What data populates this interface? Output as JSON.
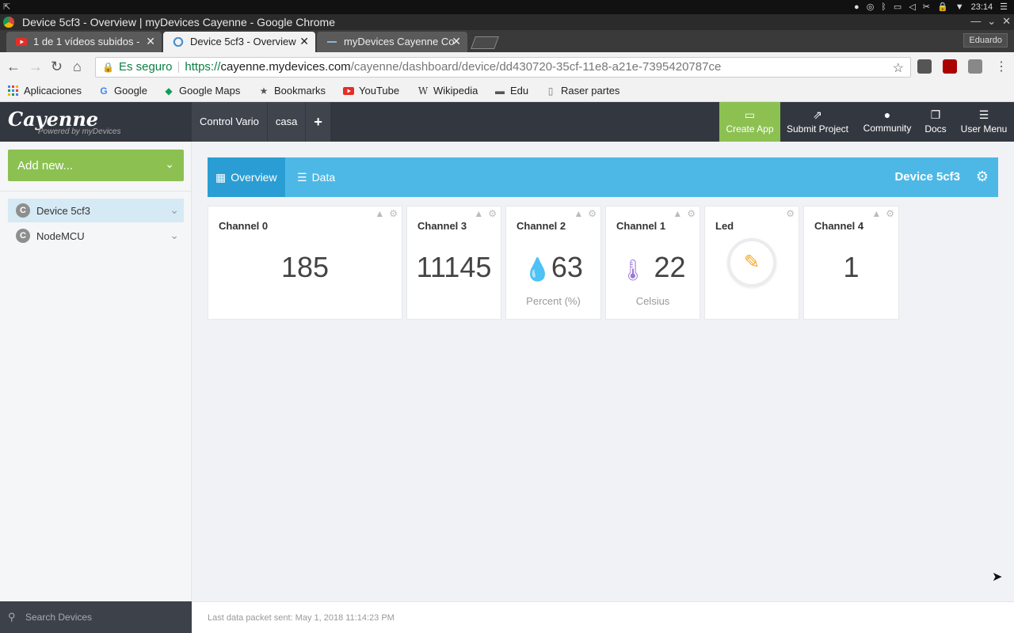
{
  "os": {
    "clock": "23:14",
    "tray_icons": [
      "chrome-icon",
      "network-icon",
      "bluetooth-icon",
      "display-icon",
      "volume-icon",
      "scissors-icon",
      "lock-icon",
      "dropdown-icon",
      "menu-icon"
    ]
  },
  "window": {
    "title": "Device 5cf3 - Overview | myDevices Cayenne - Google Chrome"
  },
  "tabs": [
    {
      "label": "1 de 1 vídeos subidos -",
      "favicon": "youtube-icon",
      "active": false
    },
    {
      "label": "Device 5cf3 - Overview",
      "favicon": "cayenne-icon",
      "active": true
    },
    {
      "label": "myDevices Cayenne Co",
      "favicon": "mydevices-icon",
      "active": false
    }
  ],
  "profile": "Eduardo",
  "address": {
    "secure_label": "Es seguro",
    "scheme": "https://",
    "host": "cayenne.mydevices.com",
    "path": "/cayenne/dashboard/device/dd430720-35cf-11e8-a21e-7395420787ce"
  },
  "bookmarks": [
    {
      "label": "Aplicaciones",
      "icon": "apps-grid-icon"
    },
    {
      "label": "Google",
      "icon": "google-icon"
    },
    {
      "label": "Google Maps",
      "icon": "maps-icon"
    },
    {
      "label": "Bookmarks",
      "icon": "star-icon"
    },
    {
      "label": "YouTube",
      "icon": "youtube-icon"
    },
    {
      "label": "Wikipedia",
      "icon": "wikipedia-icon"
    },
    {
      "label": "Edu",
      "icon": "folder-icon"
    },
    {
      "label": "Raser partes",
      "icon": "page-icon"
    }
  ],
  "app": {
    "logo": "Cayenne",
    "logo_sub": "Powered by myDevices",
    "projects": [
      "Control Vario",
      "casa",
      "+"
    ],
    "header_buttons": [
      {
        "label": "Create App",
        "icon": "phone-icon"
      },
      {
        "label": "Submit Project",
        "icon": "share-icon"
      },
      {
        "label": "Community",
        "icon": "chat-icon"
      },
      {
        "label": "Docs",
        "icon": "docs-icon"
      },
      {
        "label": "User Menu",
        "icon": "hamburger-icon"
      }
    ]
  },
  "sidebar": {
    "add_new": "Add new...",
    "devices": [
      {
        "label": "Device 5cf3",
        "active": true
      },
      {
        "label": "NodeMCU",
        "active": false
      }
    ],
    "search_placeholder": "Search Devices"
  },
  "overview": {
    "tabs": [
      {
        "label": "Overview",
        "icon": "dashboard-icon"
      },
      {
        "label": "Data",
        "icon": "database-icon"
      }
    ],
    "device_name": "Device 5cf3"
  },
  "widgets": [
    {
      "title": "Channel 0",
      "value": "185",
      "unit": "",
      "icon": ""
    },
    {
      "title": "Channel 3",
      "value": "11145",
      "unit": "",
      "icon": ""
    },
    {
      "title": "Channel 2",
      "value": "63",
      "unit": "Percent (%)",
      "icon": "water-drop-icon"
    },
    {
      "title": "Channel 1",
      "value": "22",
      "unit": "Celsius",
      "icon": "thermometer-icon"
    },
    {
      "title": "Led",
      "value": "",
      "unit": "",
      "icon": "led-icon"
    },
    {
      "title": "Channel 4",
      "value": "1",
      "unit": "",
      "icon": ""
    }
  ],
  "footer": {
    "last_packet": "Last data packet sent: May 1, 2018 11:14:23 PM"
  }
}
